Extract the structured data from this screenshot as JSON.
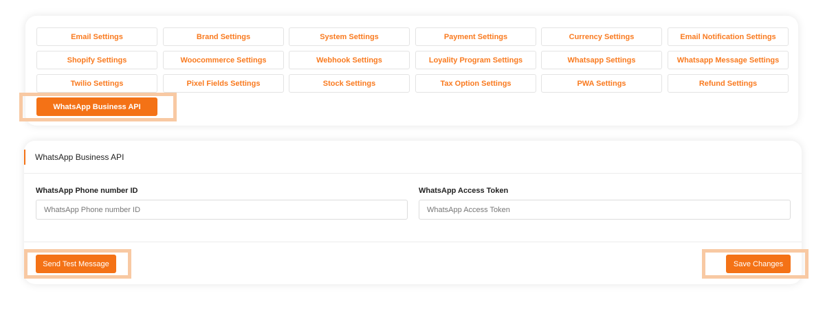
{
  "tabs": [
    {
      "label": "Email Settings"
    },
    {
      "label": "Brand Settings"
    },
    {
      "label": "System Settings"
    },
    {
      "label": "Payment Settings"
    },
    {
      "label": "Currency Settings"
    },
    {
      "label": "Email Notification Settings"
    },
    {
      "label": "Shopify Settings"
    },
    {
      "label": "Woocommerce Settings"
    },
    {
      "label": "Webhook Settings"
    },
    {
      "label": "Loyality Program Settings"
    },
    {
      "label": "Whatsapp Settings"
    },
    {
      "label": "Whatsapp Message Settings"
    },
    {
      "label": "Twilio Settings"
    },
    {
      "label": "Pixel Fields Settings"
    },
    {
      "label": "Stock Settings"
    },
    {
      "label": "Tax Option Settings"
    },
    {
      "label": "PWA Settings"
    },
    {
      "label": "Refund Settings"
    },
    {
      "label": "WhatsApp Business API",
      "active": true
    }
  ],
  "form": {
    "title": "WhatsApp Business API",
    "phone_label": "WhatsApp Phone number ID",
    "phone_placeholder": "WhatsApp Phone number ID",
    "phone_value": "",
    "token_label": "WhatsApp Access Token",
    "token_placeholder": "WhatsApp Access Token",
    "token_value": "",
    "send_test_label": "Send Test Message",
    "save_label": "Save Changes"
  },
  "colors": {
    "accent": "#f47216",
    "tab_text": "#f97a1f",
    "highlight": "#f8c9a3"
  }
}
